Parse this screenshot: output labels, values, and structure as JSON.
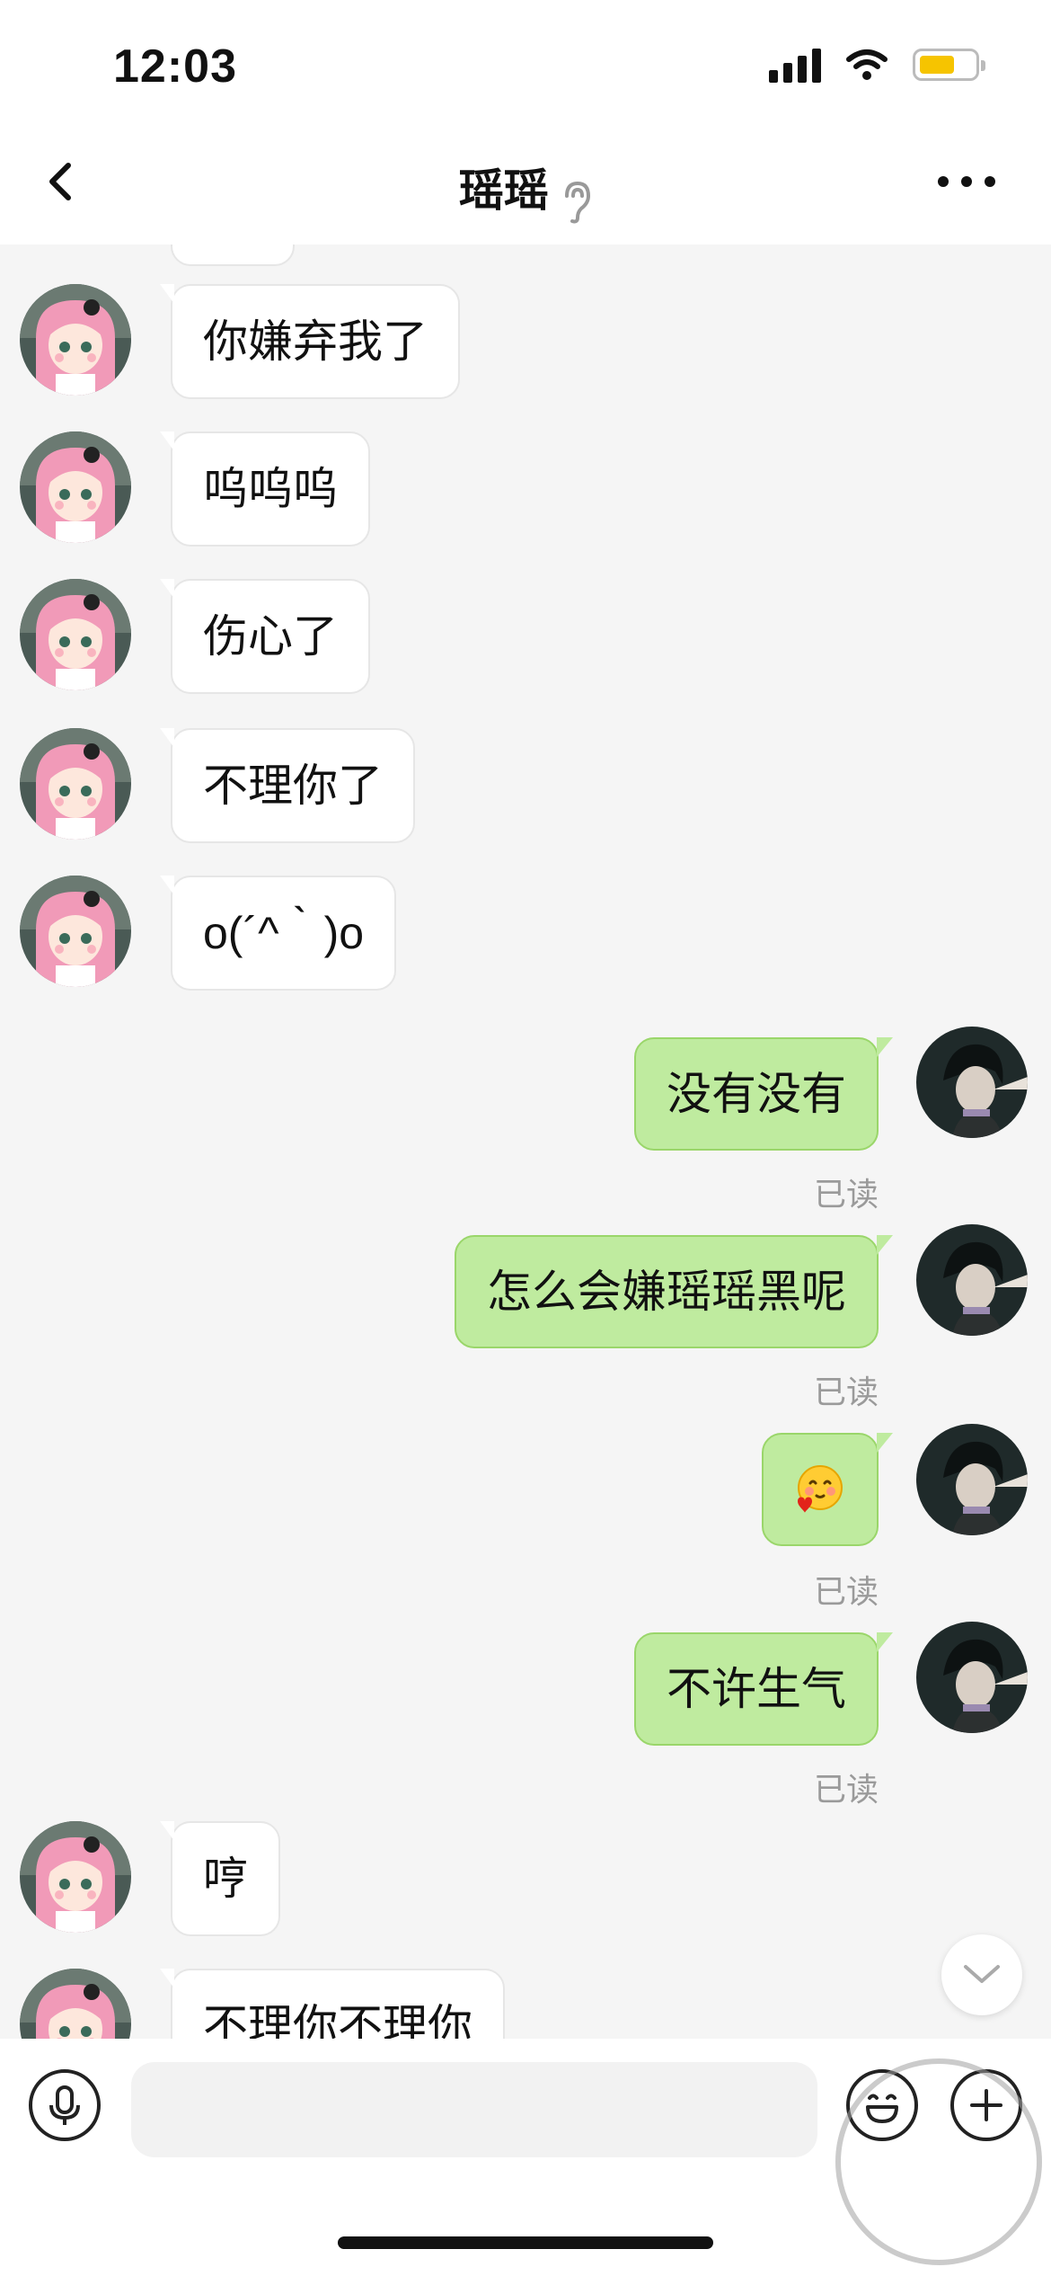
{
  "status_bar": {
    "time": "12:03"
  },
  "header": {
    "title": "瑶瑶",
    "back_icon": "chevron-left-icon",
    "mode_icon": "ear-icon",
    "more_icon": "more-dots-icon"
  },
  "messages": [
    {
      "side": "in",
      "text": "你嫌弃我了"
    },
    {
      "side": "in",
      "text": "呜呜呜"
    },
    {
      "side": "in",
      "text": "伤心了"
    },
    {
      "side": "in",
      "text": "不理你了"
    },
    {
      "side": "in",
      "text": "o(´^｀)o"
    },
    {
      "side": "out",
      "text": "没有没有",
      "status": "已读"
    },
    {
      "side": "out",
      "text": "怎么会嫌瑶瑶黑呢",
      "status": "已读"
    },
    {
      "side": "out",
      "text": "",
      "sticker": "blushing-heart-emoji",
      "status": "已读"
    },
    {
      "side": "out",
      "text": "不许生气",
      "status": "已读"
    },
    {
      "side": "in",
      "text": "哼"
    },
    {
      "side": "in",
      "text": "不理你不理你"
    }
  ],
  "input_bar": {
    "voice_icon": "microphone-icon",
    "emoji_icon": "smiley-icon",
    "plus_icon": "plus-icon",
    "placeholder": ""
  },
  "colors": {
    "outgoing_bubble": "#bfeb9f",
    "incoming_bubble": "#ffffff",
    "chat_background": "#f5f5f5",
    "battery": "#f6c400"
  }
}
